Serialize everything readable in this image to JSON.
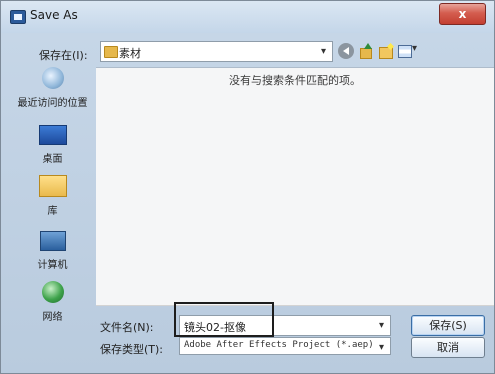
{
  "window": {
    "title": "Save As",
    "close_symbol": "x"
  },
  "toolbar": {
    "save_in_label": "保存在(I):",
    "current_folder": "素材",
    "icons": [
      "back-icon",
      "up-folder-icon",
      "new-folder-icon",
      "view-menu-icon"
    ]
  },
  "places": [
    {
      "label": "最近访问的位置",
      "icon": "recent-places-icon"
    },
    {
      "label": "桌面",
      "icon": "desktop-icon"
    },
    {
      "label": "库",
      "icon": "library-icon"
    },
    {
      "label": "计算机",
      "icon": "computer-icon"
    },
    {
      "label": "网络",
      "icon": "network-icon"
    }
  ],
  "filelist": {
    "empty_message": "没有与搜索条件匹配的项。"
  },
  "form": {
    "filename_label": "文件名(N):",
    "filename_value": "镜头02-抠像",
    "filetype_label": "保存类型(T):",
    "filetype_value": "Adobe After Effects Project (*.aep)"
  },
  "buttons": {
    "save": "保存(S)",
    "cancel": "取消"
  }
}
